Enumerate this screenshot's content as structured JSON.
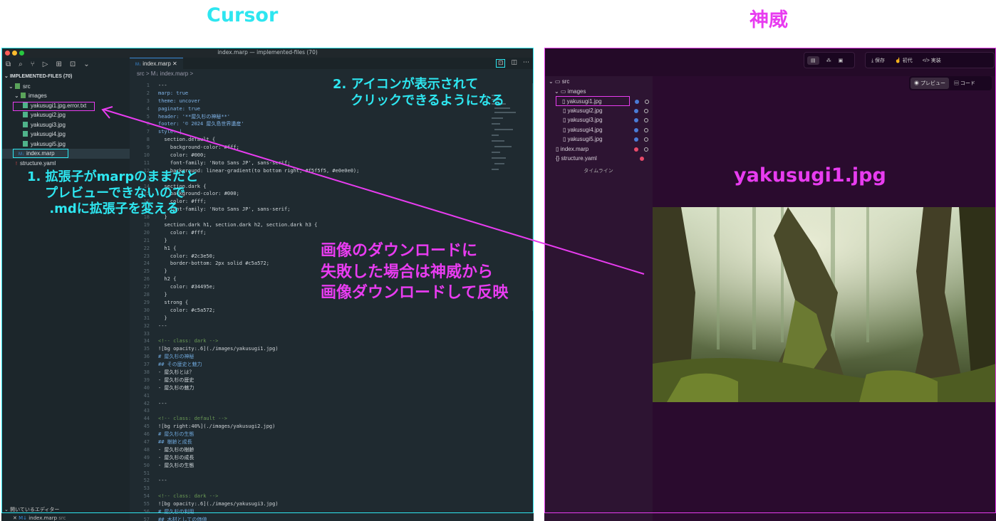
{
  "headers": {
    "left": "Cursor",
    "right": "神威"
  },
  "colors": {
    "cyan": "#2ee6f0",
    "magenta": "#e83cf0"
  },
  "vscode": {
    "window_title": "index.marp — implemented-files (70)",
    "explorer_title": "IMPLEMENTED-FILES (70)",
    "tree": [
      "src",
      "images",
      "yakusugi1.jpg.error.txt",
      "yakusugi2.jpg",
      "yakusugi3.jpg",
      "yakusugi4.jpg",
      "yakusugi5.jpg",
      "index.marp",
      "structure.yaml"
    ],
    "tab_label": "index.marp",
    "tab_icon": "M↓",
    "breadcrumb": "src > M↓ index.marp > ",
    "open_editors": "開いているエディター",
    "open_editor_item": "index.marp",
    "open_editor_dir": "src",
    "code_lines": [
      "---",
      "marp: true",
      "theme: uncover",
      "paginate: true",
      "header: '**屋久杉の神秘**'",
      "footer: '© 2024 屋久島世界遺産'",
      "style: |",
      "  section.default {",
      "    background-color: #fff;",
      "    color: #000;",
      "    font-family: 'Noto Sans JP', sans-serif;",
      "    background: linear-gradient(to bottom right, #f5f5f5, #e0e0e0);",
      "  }",
      "  section.dark {",
      "    background-color: #000;",
      "    color: #fff;",
      "    font-family: 'Noto Sans JP', sans-serif;",
      "  }",
      "  section.dark h1, section.dark h2, section.dark h3 {",
      "    color: #fff;",
      "  }",
      "  h1 {",
      "    color: #2c3e50;",
      "    border-bottom: 2px solid #c5a572;",
      "  }",
      "  h2 {",
      "    color: #34495e;",
      "  }",
      "  strong {",
      "    color: #c5a572;",
      "  }",
      "---",
      "",
      "<!-- class: dark -->",
      "![bg opacity:.6](./images/yakusugi1.jpg)",
      "# 屋久杉の神秘",
      "## その歴史と魅力",
      "- 屋久杉とは？",
      "- 屋久杉の歴史",
      "- 屋久杉の魅力",
      "",
      "---",
      "",
      "<!-- class: default -->",
      "![bg right:40%](./images/yakusugi2.jpg)",
      "# 屋久杉の生態",
      "## 樹齢と成長",
      "- 屋久杉の樹齢",
      "- 屋久杉の成長",
      "- 屋久杉の生態",
      "",
      "---",
      "",
      "<!-- class: dark -->",
      "![bg opacity:.6](./images/yakusugi3.jpg)",
      "# 屋久杉の利用",
      "## 木材としての価値"
    ]
  },
  "shinwi": {
    "toolbar": {
      "save": "保存",
      "history": "初代",
      "run": "実装"
    },
    "view_toggle": {
      "preview": "プレビュー",
      "code": "コード"
    },
    "tree": [
      "src",
      "images",
      "yakusugi1.jpg",
      "yakusugi2.jpg",
      "yakusugi3.jpg",
      "yakusugi4.jpg",
      "yakusugi5.jpg",
      "index.marp",
      "structure.yaml"
    ],
    "timeline": "タイムライン",
    "preview_title": "yakusugi1.jpg"
  },
  "annotations": {
    "step1": "1. 拡張子がmarpのままだと\n    プレビューできないので\n     .mdに拡張子を変える",
    "step2": "2. アイコンが表示されて\n    クリックできるようになる",
    "fallback": "画像のダウンロードに\n失敗した場合は神威から\n画像ダウンロードして反映"
  }
}
